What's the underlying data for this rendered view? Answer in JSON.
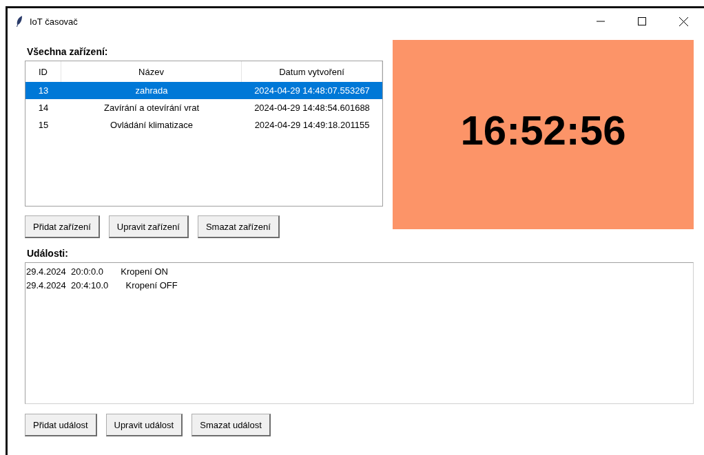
{
  "window": {
    "title": "IoT časovač"
  },
  "devices": {
    "label": "Všechna zařízení:",
    "columns": [
      "ID",
      "Název",
      "Datum vytvoření"
    ],
    "rows": [
      {
        "cells": [
          "13",
          "zahrada",
          "2024-04-29 14:48:07.553267"
        ],
        "selected": true
      },
      {
        "cells": [
          "14",
          "Zavírání a otevírání vrat",
          "2024-04-29 14:48:54.601688"
        ],
        "selected": false
      },
      {
        "cells": [
          "15",
          "Ovládání klimatizace",
          "2024-04-29 14:49:18.201155"
        ],
        "selected": false
      }
    ],
    "buttons": [
      "Přidat zařízení",
      "Upravit zařízení",
      "Smazat zařízení"
    ]
  },
  "clock": {
    "time": "16:52:56"
  },
  "events": {
    "label": "Události:",
    "items": [
      "29.4.2024  20:0:0.0       Kropení ON",
      "29.4.2024  20:4:10.0       Kropení OFF"
    ],
    "buttons": [
      "Přidat událost",
      "Upravit událost",
      "Smazat událost"
    ]
  }
}
